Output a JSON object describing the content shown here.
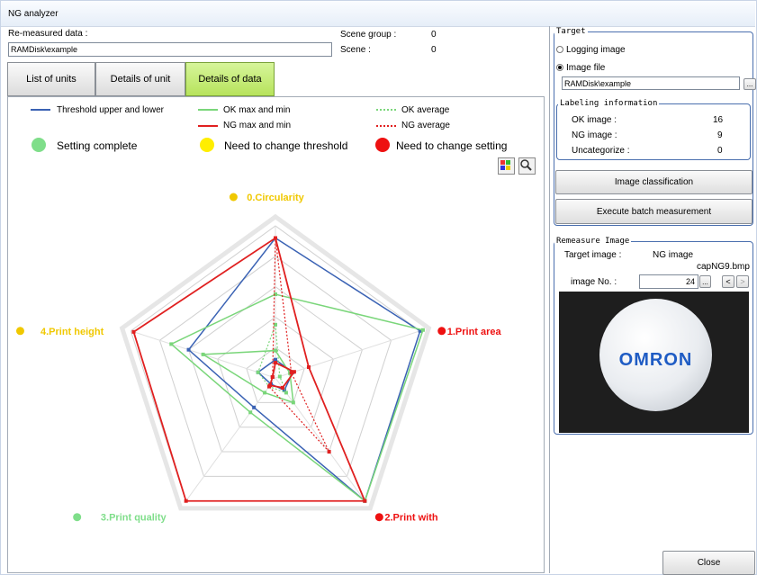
{
  "window": {
    "title": "NG analyzer"
  },
  "header": {
    "remeasured_label": "Re-measured data :",
    "remeasured_value": "RAMDisk\\example",
    "scene_group_label": "Scene group :",
    "scene_group_value": "0",
    "scene_label": "Scene :",
    "scene_value": "0"
  },
  "tabs": [
    {
      "label": "List of units"
    },
    {
      "label": "Details of unit"
    },
    {
      "label": "Details of data"
    }
  ],
  "legend": {
    "threshold": "Threshold upper and lower",
    "ok_max_min": "OK max and min",
    "ok_average": "OK average",
    "ng_max_min": "NG max and min",
    "ng_average": "NG average",
    "setting_complete": "Setting complete",
    "need_threshold": "Need to change threshold",
    "need_setting": "Need to change setting"
  },
  "colors": {
    "threshold": "#3a62b4",
    "ok": "#7ad67a",
    "ng": "#e02020",
    "status_complete": "#7fde8a",
    "status_threshold": "#ffee00",
    "status_setting": "#ee1111"
  },
  "toolbar_icons": [
    "chart-color-icon",
    "zoom-icon"
  ],
  "chart_data": {
    "type": "radar",
    "axes": [
      {
        "label": "0.Circularity",
        "status": "need_threshold"
      },
      {
        "label": "1.Print area",
        "status": "need_setting"
      },
      {
        "label": "2.Print with",
        "status": "need_setting"
      },
      {
        "label": "3.Print quality",
        "status": "complete"
      },
      {
        "label": "4.Print height",
        "status": "need_threshold"
      }
    ],
    "rlim": [
      0,
      1
    ],
    "grid_levels": [
      0.2,
      0.4,
      0.6,
      0.8,
      1.0
    ],
    "series": [
      {
        "legend_key": "threshold",
        "values": [
          0.92,
          1.0,
          1.0,
          0.24,
          0.6
        ]
      },
      {
        "legend_key": "threshold",
        "values": [
          0.12,
          0.12,
          0.1,
          0.05,
          0.12
        ]
      },
      {
        "legend_key": "ok_max_min",
        "values": [
          0.55,
          1.02,
          1.0,
          0.28,
          0.72
        ]
      },
      {
        "legend_key": "ok_max_min",
        "values": [
          0.18,
          0.1,
          0.2,
          0.12,
          0.5
        ]
      },
      {
        "legend_key": "ok_average",
        "values": [
          0.35,
          0.03,
          0.12,
          0.07,
          0.12
        ]
      },
      {
        "legend_key": "ng_max_min",
        "values": [
          0.92,
          0.23,
          1.0,
          1.0,
          0.98
        ]
      },
      {
        "legend_key": "ng_max_min",
        "values": [
          0.1,
          0.13,
          0.08,
          0.06,
          0.02
        ]
      },
      {
        "legend_key": "ng_average",
        "values": [
          0.92,
          0.11,
          0.6,
          0.07,
          0.02
        ]
      }
    ]
  },
  "target": {
    "title": "Target",
    "logging_image": "Logging image",
    "image_file": "Image file",
    "path": "RAMDisk\\example",
    "browse": "..."
  },
  "labeling": {
    "title": "Labeling information",
    "ok_label": "OK image :",
    "ok_value": "16",
    "ng_label": "NG image :",
    "ng_value": "9",
    "uncat_label": "Uncategorize :",
    "uncat_value": "0"
  },
  "buttons": {
    "classification": "Image classification",
    "batch": "Execute batch measurement",
    "close": "Close"
  },
  "remeasure": {
    "title": "Remeasure Image",
    "target_label": "Target image :",
    "target_value": "NG image",
    "file": "capNG9.bmp",
    "image_no_label": "image No. :",
    "image_no_value": "24",
    "browse": "...",
    "prev": "<",
    "next": ">",
    "logo_text": "OMRON"
  }
}
